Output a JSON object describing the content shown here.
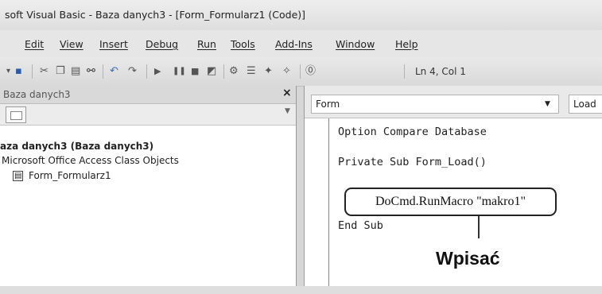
{
  "window": {
    "title": "soft Visual Basic - Baza danych3 - [Form_Formularz1 (Code)]"
  },
  "menubar": {
    "items": [
      {
        "label": "Edit"
      },
      {
        "label": "View"
      },
      {
        "label": "Insert"
      },
      {
        "label": "Debug"
      },
      {
        "label": "Run"
      },
      {
        "label": "Tools"
      },
      {
        "label": "Add-Ins"
      },
      {
        "label": "Window"
      },
      {
        "label": "Help"
      }
    ]
  },
  "toolbar": {
    "status": "Ln 4, Col 1"
  },
  "project_panel": {
    "title": "Baza danych3",
    "close_glyph": "×",
    "root": "aza danych3 (Baza danych3)",
    "folder": "Microsoft Office Access Class Objects",
    "item": "Form_Formularz1"
  },
  "code_window": {
    "object_select": "Form",
    "procedure_select": "Load",
    "lines": {
      "option": "Option Compare Database",
      "sub": "Private Sub Form_Load()",
      "call": "DoCmd.RunMacro \"makro1\"",
      "end": "End Sub"
    }
  },
  "annotation": {
    "label": "Wpisać"
  },
  "icons": [
    "save-icon",
    "cut-icon",
    "copy-icon",
    "paste-icon",
    "find-icon",
    "undo-icon",
    "redo-icon",
    "run-icon",
    "break-icon",
    "reset-icon",
    "design-mode-icon",
    "project-explorer-icon",
    "properties-icon",
    "object-browser-icon",
    "toolbox-icon",
    "help-icon",
    "folder-icon",
    "form-icon"
  ]
}
